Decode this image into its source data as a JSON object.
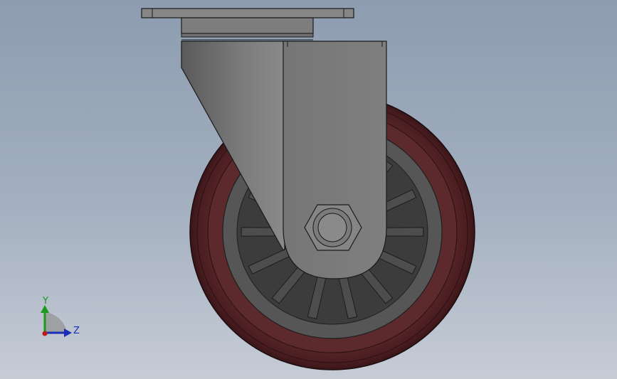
{
  "viewport": {
    "background_top": "#8d9cb0",
    "background_bottom": "#c6ccd6"
  },
  "model": {
    "part": "swivel-caster",
    "colors": {
      "bracket": "#7b7b7b",
      "bracket_dark": "#5c5c5c",
      "plate": "#858585",
      "tire": "#5b2a2c",
      "tire_dark": "#3a1618",
      "hub": "#4b4b4b",
      "hub_dark": "#2e2e2e",
      "edge": "#1a1a1a"
    }
  },
  "triad": {
    "y_label": "Y",
    "z_label": "Z",
    "y_color": "#1a9a1a",
    "z_color": "#1a2fb8",
    "origin_color": "#c01818"
  }
}
